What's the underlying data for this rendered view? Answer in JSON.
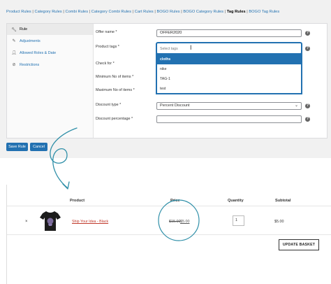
{
  "tabs": [
    "Product Rules",
    "Category Rules",
    "Combi Rules",
    "Category Combi Rules",
    "Cart Rules",
    "BOGO Rules",
    "BOGO Category Rules",
    "Tag Rules",
    "BOGO Tag Rules"
  ],
  "active_tab": "Tag Rules",
  "sidebar": {
    "items": [
      {
        "label": "Rule",
        "icon": "wrench-icon"
      },
      {
        "label": "Adjustments",
        "icon": "pencil-icon"
      },
      {
        "label": "Allowed Roles & Date",
        "icon": "user-icon"
      },
      {
        "label": "Restrictions",
        "icon": "ban-icon"
      }
    ]
  },
  "form": {
    "offer_name_label": "Offer name *",
    "offer_name_value": "OFFER2020",
    "product_tags_label": "Product tags *",
    "product_tags_placeholder": "Select tags",
    "tag_options": [
      "cloths",
      "nike",
      "TAG-1",
      "test"
    ],
    "check_for_label": "Check for *",
    "min_items_label": "Minimum No of items *",
    "max_items_label": "Maximum No of items *",
    "discount_type_label": "Discount type *",
    "discount_type_value": "Percent Discount",
    "discount_percentage_label": "Discount percentage *",
    "discount_percentage_value": ""
  },
  "buttons": {
    "save": "Save Rule",
    "cancel": "Cancel"
  },
  "cart": {
    "headers": {
      "product": "Product",
      "price": "Price",
      "quantity": "Quantity",
      "subtotal": "Subtotal"
    },
    "remove_symbol": "×",
    "item": {
      "name": "Ship Your Idea - Black",
      "price_old": "$15.00",
      "price_new": "$5.00",
      "quantity": "1",
      "subtotal": "$5.00"
    },
    "update_button": "UPDATE BASKET"
  },
  "colors": {
    "accent": "#2271b1",
    "annotation": "#2f8fa8",
    "link_red": "#c0392b"
  }
}
